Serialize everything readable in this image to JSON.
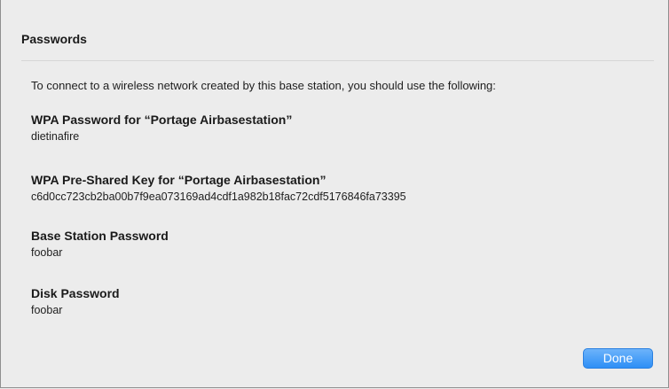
{
  "dialog": {
    "header": "Passwords",
    "intro": "To connect to a wireless network created by this base station, you should use the following:",
    "items": [
      {
        "label": "WPA Password for “Portage Airbasestation”",
        "value": "dietinafire"
      },
      {
        "label": "WPA Pre-Shared Key for “Portage Airbasestation”",
        "value": "c6d0cc723cb2ba00b7f9ea073169ad4cdf1a982b18fac72cdf5176846fa73395"
      },
      {
        "label": "Base Station Password",
        "value": "foobar"
      },
      {
        "label": "Disk Password",
        "value": "foobar"
      }
    ],
    "done_label": "Done"
  },
  "colors": {
    "background": "#ececec",
    "accent": "#3d96f7",
    "text": "#1e1e1e"
  }
}
